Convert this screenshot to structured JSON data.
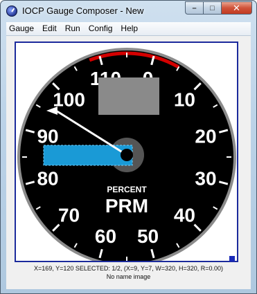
{
  "window": {
    "title": "IOCP Gauge Composer - New",
    "caption": {
      "minimize": "–",
      "maximize": "□",
      "close": "✕"
    }
  },
  "menu": {
    "items": [
      {
        "name": "menu-gauge",
        "label": "Gauge"
      },
      {
        "name": "menu-edit",
        "label": "Edit"
      },
      {
        "name": "menu-run",
        "label": "Run"
      },
      {
        "name": "menu-config",
        "label": "Config"
      },
      {
        "name": "menu-help",
        "label": "Help"
      }
    ]
  },
  "gauge": {
    "scale_labels": [
      "0",
      "10",
      "20",
      "30",
      "40",
      "50",
      "60",
      "70",
      "80",
      "90",
      "100",
      "110"
    ],
    "caption_small": "PERCENT",
    "caption_large": "PRM",
    "needle_value": 95,
    "colors": {
      "face": "#000000",
      "bezel": "#8c8c8c",
      "redline": "#d40000",
      "display_box": "#8a8a8a",
      "hub": "#555555",
      "selection": "#1a9ad6",
      "needle": "#ffffff"
    }
  },
  "status": {
    "line1": "X=169, Y=120      SELECTED: 1/2, (X=9, Y=7, W=320, H=320, R=0.00)",
    "line2": "No name image"
  }
}
